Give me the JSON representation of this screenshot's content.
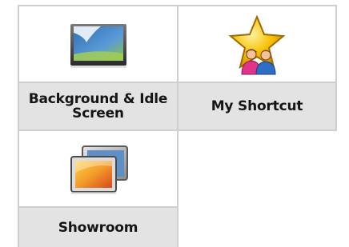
{
  "tiles": [
    {
      "label": "Background & Idle Screen",
      "icon": "background-screen-icon"
    },
    {
      "label": "My Shortcut",
      "icon": "star-users-icon"
    },
    {
      "label": "Showroom",
      "icon": "showroom-icon"
    }
  ],
  "colors": {
    "tile_border": "#cfcfcf",
    "label_background": "#e3e3e3",
    "label_text": "#151515",
    "star_gold": "#f5b800",
    "screen_blue": "#4a86c8",
    "screen_green": "#8ec63f",
    "showroom_orange": "#f39c2a"
  }
}
